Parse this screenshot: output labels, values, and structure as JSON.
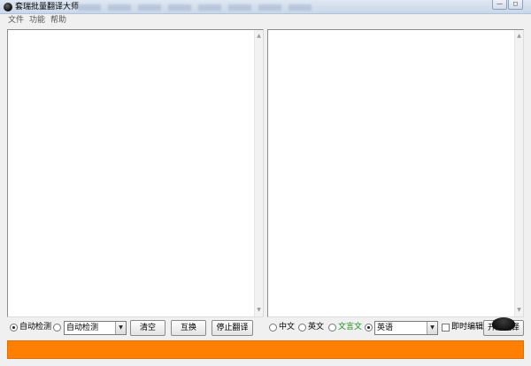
{
  "window": {
    "title": "套瑞批量翻译大师",
    "minimize_glyph": "—",
    "restore_glyph": "◻"
  },
  "menu": {
    "items": [
      "文件",
      "功能",
      "帮助"
    ]
  },
  "controls": {
    "source_detect_label": "自动检测",
    "source_select_value": "自动检测",
    "clear_label": "清空",
    "swap_label": "互换",
    "stop_label": "停止翻译",
    "opt_chinese": "中文",
    "opt_english": "英文",
    "opt_classical": "文言文",
    "target_select_value": "英语",
    "instant_edit_label": "即时编辑",
    "start_label": "开始翻译"
  },
  "colors": {
    "progress": "#ff8000",
    "classical_label": "#1a8a1a"
  },
  "icons": {
    "app": "app-logo-icon",
    "scroll_up": "▲",
    "scroll_down": "▼",
    "dropdown": "▼"
  }
}
